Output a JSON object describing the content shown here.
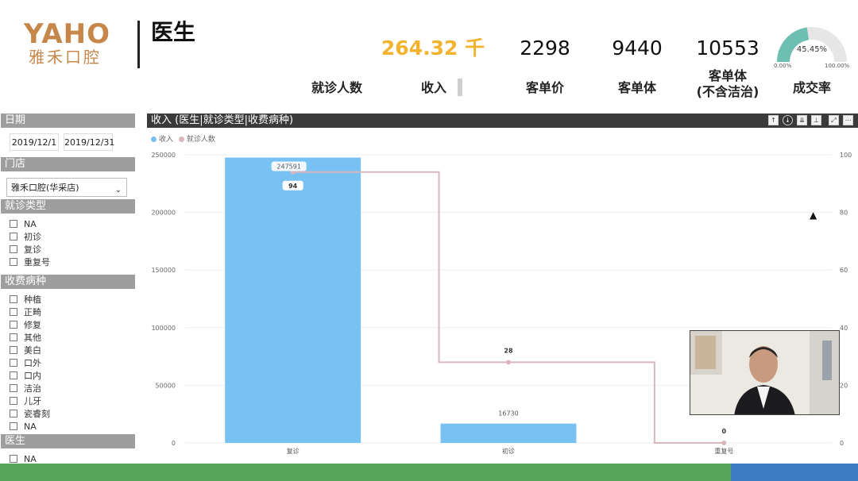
{
  "header": {
    "logo_mark": "YAHO",
    "logo_sub": "雅禾口腔",
    "title": "医生"
  },
  "kpis": [
    {
      "value": "264.32 千",
      "label": "收入",
      "color": "#f3b32e"
    },
    {
      "value": "2298",
      "label": "客单价"
    },
    {
      "value": "9440",
      "label": "客单体"
    },
    {
      "value": "10553",
      "label": "客单体\n(不含洁治)"
    }
  ],
  "kpi_first_label": "就诊人数",
  "gauge": {
    "value_text": "45.45%",
    "min_text": "0.00%",
    "max_text": "100.00%",
    "label": "成交率",
    "fraction": 0.4545,
    "color": "#6cbfb1"
  },
  "filters": {
    "date_header": "日期",
    "date_start": "2019/12/1",
    "date_end": "2019/12/31",
    "store_header": "门店",
    "store_value": "雅禾口腔(华采店)",
    "visit_type_header": "就诊类型",
    "visit_types": [
      "NA",
      "初诊",
      "复诊",
      "重复号"
    ],
    "disease_header": "收费病种",
    "diseases": [
      "种植",
      "正畸",
      "修复",
      "其他",
      "美白",
      "口外",
      "口内",
      "洁治",
      "儿牙",
      "瓷睿刻",
      "NA"
    ],
    "doctor_header": "医生",
    "doctors": [
      "NA"
    ]
  },
  "chart": {
    "header_title": "收入  (医生|就诊类型|收费病种)",
    "legend": [
      "收入",
      "就诊人数"
    ],
    "toolbar_icons": [
      "drill-up-icon",
      "drill-down-icon",
      "expand-level-icon",
      "hierarchy-icon",
      "focus-mode-icon",
      "more-options-icon"
    ]
  },
  "chart_data": {
    "type": "bar",
    "categories": [
      "复诊",
      "初诊",
      "重复号"
    ],
    "series": [
      {
        "name": "收入",
        "type": "bar",
        "values": [
          247591,
          16730,
          0
        ],
        "labels": [
          "247591",
          "16730",
          ""
        ],
        "color": "#78c1f3"
      },
      {
        "name": "就诊人数",
        "type": "step-line",
        "values": [
          94,
          28,
          0
        ],
        "labels": [
          "94",
          "28",
          "0"
        ],
        "color": "#d9b7bd"
      }
    ],
    "y_left": {
      "range": [
        0,
        250000
      ],
      "ticks": [
        "0",
        "50000",
        "100000",
        "150000",
        "200000",
        "250000"
      ]
    },
    "y_right": {
      "range": [
        0,
        100
      ],
      "ticks": [
        "0",
        "20",
        "40",
        "60",
        "80",
        "100"
      ]
    },
    "grid": true,
    "legend_position": "top-left"
  }
}
